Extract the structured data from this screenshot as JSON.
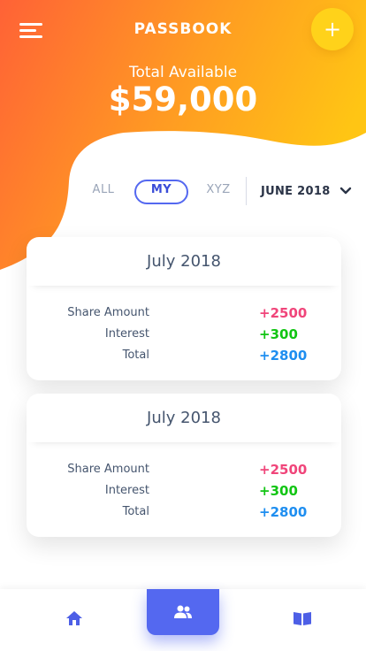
{
  "header": {
    "title": "PASSBOOK",
    "add_icon": "plus-icon",
    "menu_icon": "menu-icon"
  },
  "summary": {
    "label": "Total Available",
    "amount": "$59,000"
  },
  "filters": {
    "tabs": [
      "ALL",
      "MY",
      "XYZ"
    ],
    "active_tab": "MY",
    "month": "JUNE 2018"
  },
  "cards": [
    {
      "title": "July 2018",
      "rows": [
        {
          "label": "Share Amount",
          "value": "+2500",
          "color": "#f0457a"
        },
        {
          "label": "Interest",
          "value": "+300",
          "color": "#12c514"
        },
        {
          "label": "Total",
          "value": "+2800",
          "color": "#1e8ef0"
        }
      ]
    },
    {
      "title": "July 2018",
      "rows": [
        {
          "label": "Share Amount",
          "value": "+2500",
          "color": "#f0457a"
        },
        {
          "label": "Interest",
          "value": "+300",
          "color": "#12c514"
        },
        {
          "label": "Total",
          "value": "+2800",
          "color": "#1e8ef0"
        }
      ]
    }
  ],
  "bottom_nav": {
    "items": [
      "home-icon",
      "people-icon",
      "book-icon"
    ],
    "active": "people-icon"
  },
  "colors": {
    "accent": "#5468f0",
    "gradient_start": "#ff6a3a",
    "gradient_end": "#ffc21a"
  }
}
